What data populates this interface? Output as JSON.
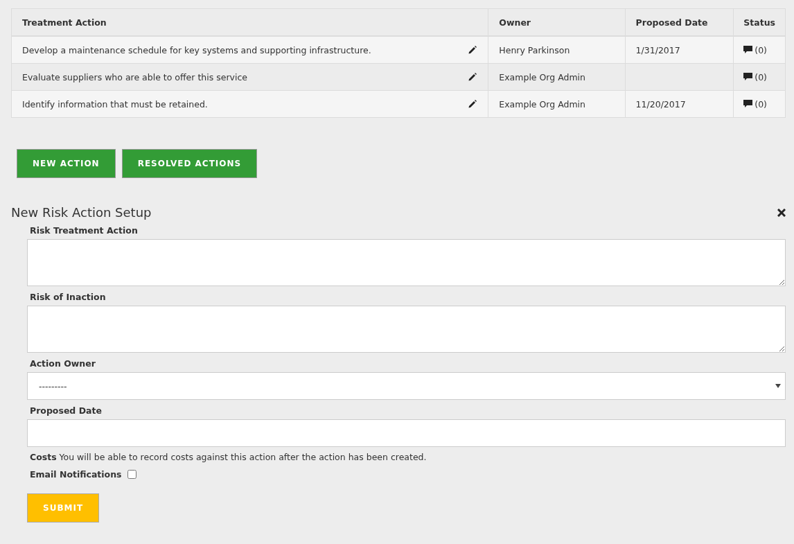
{
  "table": {
    "columns": [
      "Treatment Action",
      "Owner",
      "Proposed Date",
      "Status"
    ],
    "rows": [
      {
        "action": "Develop a maintenance schedule for key systems and supporting infrastructure.",
        "owner": "Henry Parkinson",
        "date": "1/31/2017",
        "comments": "(0)"
      },
      {
        "action": "Evaluate suppliers who are able to offer this service",
        "owner": "Example Org Admin",
        "comments": "(0)"
      },
      {
        "action": "Identify information that must be retained.",
        "owner": "Example Org Admin",
        "date": "11/20/2017",
        "comments": "(0)"
      }
    ]
  },
  "buttons": [
    "NEW ACTION",
    "RESOLVED ACTIONS"
  ],
  "form": {
    "title": "New Risk Action Setup",
    "fields": [
      {
        "kind": "textarea",
        "label": "Risk Treatment Action"
      },
      {
        "kind": "textarea",
        "label": "Risk of Inaction"
      },
      {
        "kind": "select",
        "label": "Action Owner",
        "value": "---------"
      },
      {
        "kind": "input",
        "label": "Proposed Date"
      }
    ],
    "costs_note": "**Costs** You will be able to record costs against this action after the action has been created.",
    "email_notifications": {
      "label": "Email Notifications",
      "checked": false
    },
    "submit": "SUBMIT"
  }
}
